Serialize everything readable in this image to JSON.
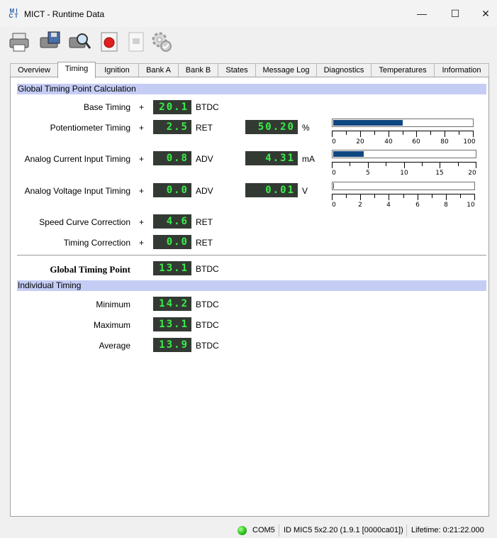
{
  "window": {
    "logo_text": "MICT",
    "title": "MICT - Runtime Data",
    "minimize_glyph": "—",
    "maximize_glyph": "☐",
    "close_glyph": "✕"
  },
  "toolbar": {
    "buttons": [
      {
        "name": "printer-icon"
      },
      {
        "name": "save-icon"
      },
      {
        "name": "search-icon"
      },
      {
        "name": "record-icon"
      },
      {
        "name": "document-icon"
      },
      {
        "name": "settings-icon"
      }
    ]
  },
  "tabs": [
    "Overview",
    "Timing",
    "Ignition",
    "Bank A",
    "Bank B",
    "States",
    "Message Log",
    "Diagnostics",
    "Temperatures",
    "Information"
  ],
  "active_tab": "Timing",
  "global": {
    "section_title": "Global Timing Point Calculation",
    "rows": [
      {
        "label": "Base Timing",
        "plus": "+",
        "value": "20.1",
        "unit": "BTDC"
      },
      {
        "label": "Potentiometer Timing",
        "plus": "+",
        "value": "2.5",
        "unit": "RET",
        "input_value": "50.20",
        "input_unit": "%",
        "bar": {
          "fraction": 0.502,
          "ticks": [
            "0",
            "20",
            "40",
            "60",
            "80",
            "100"
          ]
        }
      },
      {
        "label": "Analog Current Input Timing",
        "plus": "+",
        "value": "0.8",
        "unit": "ADV",
        "input_value": "4.31",
        "input_unit": "mA",
        "bar": {
          "fraction": 0.2155,
          "ticks": [
            "0",
            "5",
            "10",
            "15",
            "20"
          ]
        }
      },
      {
        "label": "Analog Voltage Input Timing",
        "plus": "+",
        "value": "0.0",
        "unit": "ADV",
        "input_value": "0.01",
        "input_unit": "V",
        "bar": {
          "fraction": 0.001,
          "ticks": [
            "0",
            "2",
            "4",
            "6",
            "8",
            "10"
          ]
        }
      },
      {
        "label": "Speed Curve Correction",
        "plus": "+",
        "value": "4.6",
        "unit": "RET"
      },
      {
        "label": "Timing Correction",
        "plus": "+",
        "value": "0.0",
        "unit": "RET"
      }
    ],
    "result": {
      "label": "Global Timing Point",
      "value": "13.1",
      "unit": "BTDC"
    }
  },
  "individual": {
    "section_title": "Individual Timing",
    "rows": [
      {
        "label": "Minimum",
        "value": "14.2",
        "unit": "BTDC"
      },
      {
        "label": "Maximum",
        "value": "13.1",
        "unit": "BTDC"
      },
      {
        "label": "Average",
        "value": "13.9",
        "unit": "BTDC"
      }
    ]
  },
  "status": {
    "port": "COM5",
    "device": "ID MIC5 5x2.20 (1.9.1 [0000ca01])",
    "lifetime": "Lifetime: 0:21:22.000",
    "led_color": "#2fbf1f"
  },
  "colors": {
    "section_bar": "#c5cdf5",
    "lcd_background": "#333a33",
    "lcd_digits": "#3aef4a",
    "bar_fill": "#0f4780"
  }
}
